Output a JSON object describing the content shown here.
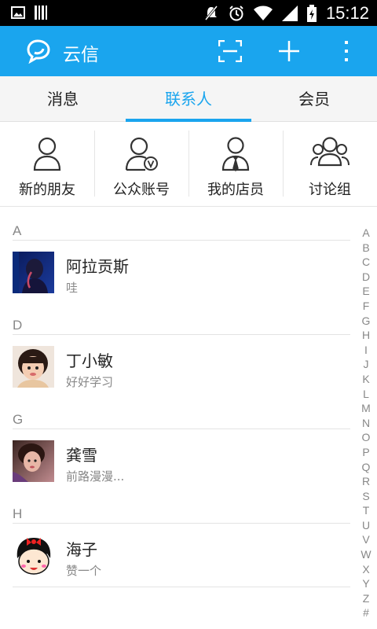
{
  "status_bar": {
    "time": "15:12",
    "icons": [
      "image-icon",
      "barcode-icon",
      "mute-icon",
      "alarm-icon",
      "wifi-icon",
      "signal-icon",
      "battery-icon"
    ]
  },
  "app_bar": {
    "title": "云信",
    "accent": "#1aa5ee",
    "actions": [
      "scan-icon",
      "add-icon",
      "more-icon"
    ]
  },
  "tabs": [
    {
      "label": "消息"
    },
    {
      "label": "联系人",
      "active": true
    },
    {
      "label": "会员"
    }
  ],
  "shortcuts": [
    {
      "label": "新的朋友",
      "icon": "person-icon"
    },
    {
      "label": "公众账号",
      "icon": "official-account-icon"
    },
    {
      "label": "我的店员",
      "icon": "staff-icon"
    },
    {
      "label": "讨论组",
      "icon": "group-icon"
    }
  ],
  "sections": [
    {
      "letter": "A",
      "contacts": [
        {
          "name": "阿拉贡斯",
          "subtitle": "哇"
        }
      ]
    },
    {
      "letter": "D",
      "contacts": [
        {
          "name": "丁小敏",
          "subtitle": "好好学习"
        }
      ]
    },
    {
      "letter": "G",
      "contacts": [
        {
          "name": "龚雪",
          "subtitle": "前路漫漫..."
        }
      ]
    },
    {
      "letter": "H",
      "contacts": [
        {
          "name": "海子",
          "subtitle": "赞一个"
        }
      ]
    }
  ],
  "index_letters": [
    "A",
    "B",
    "C",
    "D",
    "E",
    "F",
    "G",
    "H",
    "I",
    "J",
    "K",
    "L",
    "M",
    "N",
    "O",
    "P",
    "Q",
    "R",
    "S",
    "T",
    "U",
    "V",
    "W",
    "X",
    "Y",
    "Z",
    "#"
  ]
}
